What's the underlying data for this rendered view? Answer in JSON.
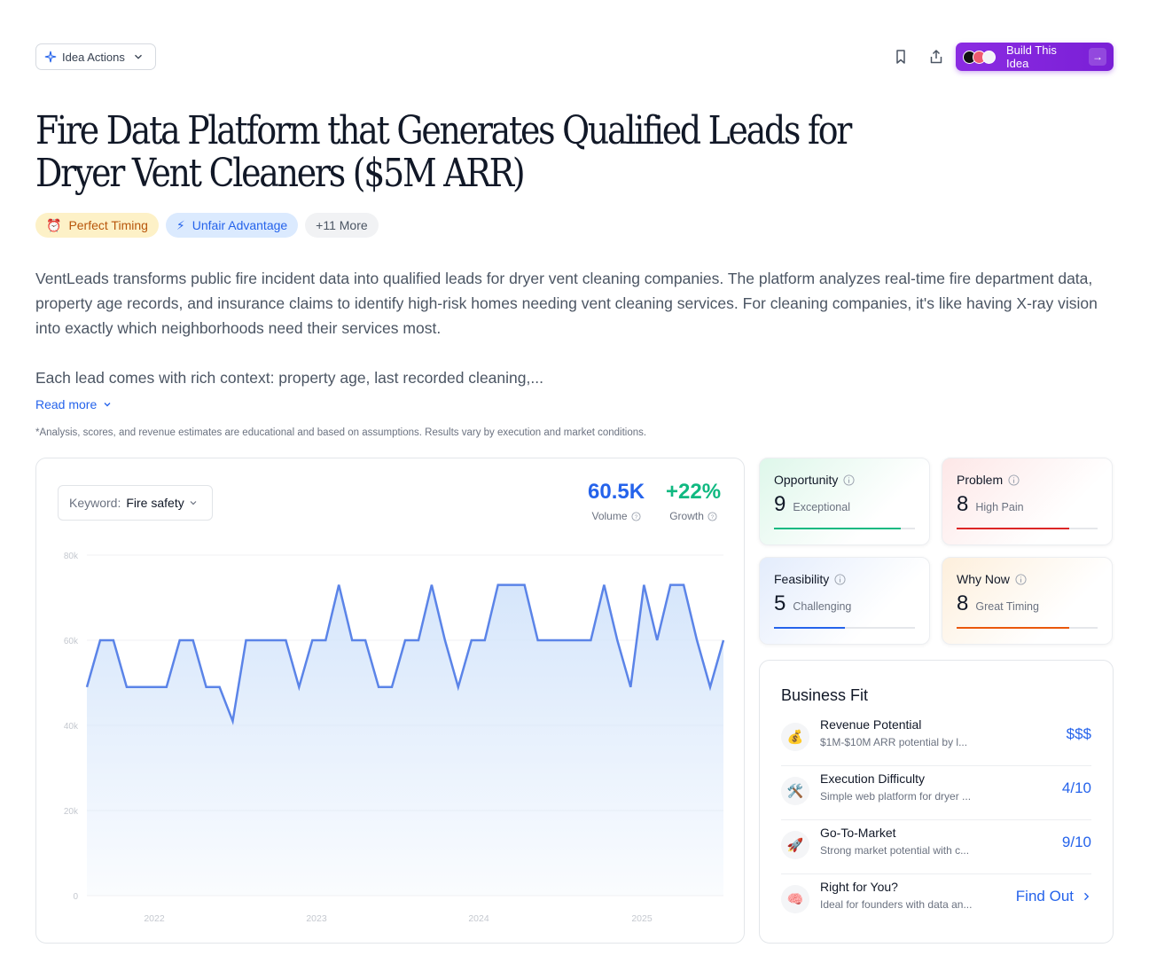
{
  "header": {
    "idea_actions_label": "Idea Actions",
    "build_label": "Build This Idea"
  },
  "title": "Fire Data Platform that Generates Qualified Leads for Dryer Vent Cleaners ($5M ARR)",
  "tags": [
    {
      "label": "Perfect Timing",
      "icon": "alarm-clock-icon"
    },
    {
      "label": "Unfair Advantage",
      "icon": "lightning-icon"
    },
    {
      "label": "+11 More"
    }
  ],
  "description": {
    "paragraph1": "VentLeads transforms public fire incident data into qualified leads for dryer vent cleaning companies. The platform analyzes real-time fire department data, property age records, and insurance claims to identify high-risk homes needing vent cleaning services. For cleaning companies, it's like having X-ray vision into exactly which neighborhoods need their services most.",
    "paragraph2": "Each lead comes with rich context: property age, last recorded cleaning,...",
    "read_more": "Read more",
    "disclaimer": "*Analysis, scores, and revenue estimates are educational and based on assumptions. Results vary by execution and market conditions."
  },
  "trend": {
    "keyword_label": "Keyword:",
    "keyword_value": "Fire safety",
    "volume": "60.5K",
    "volume_label": "Volume",
    "growth": "+22%",
    "growth_label": "Growth"
  },
  "chart_data": {
    "type": "area",
    "ylim": [
      0,
      80000
    ],
    "y_ticks": [
      "80k",
      "60k",
      "40k",
      "20k",
      "0"
    ],
    "x_ticks": [
      "2022",
      "2023",
      "2024",
      "2025"
    ],
    "grid": true,
    "series": [
      {
        "values": [
          49000,
          60000,
          60000,
          49000,
          49000,
          49000,
          49000,
          60000,
          60000,
          49000,
          49000,
          41000,
          60000,
          60000,
          60000,
          60000,
          49000,
          60000,
          60000,
          73000,
          60000,
          60000,
          49000,
          49000,
          60000,
          60000,
          73000,
          60000,
          49000,
          60000,
          60000,
          73000,
          73000,
          73000,
          60000,
          60000,
          60000,
          60000,
          60000,
          73000,
          60000,
          49000,
          73000,
          60000,
          73000,
          73000,
          60000,
          49000,
          60000
        ]
      }
    ],
    "colors": {
      "line": "#5b84e8",
      "fill": "#d6e6fb"
    }
  },
  "scores": [
    {
      "title": "Opportunity",
      "value": "9",
      "sub": "Exceptional",
      "fill": 0.9,
      "color": "#10b981"
    },
    {
      "title": "Problem",
      "value": "8",
      "sub": "High Pain",
      "fill": 0.8,
      "color": "#dc2626"
    },
    {
      "title": "Feasibility",
      "value": "5",
      "sub": "Challenging",
      "fill": 0.5,
      "color": "#2563eb"
    },
    {
      "title": "Why Now",
      "value": "8",
      "sub": "Great Timing",
      "fill": 0.8,
      "color": "#ea580c"
    }
  ],
  "business_fit": {
    "title": "Business Fit",
    "rows": [
      {
        "icon": "money-bag-icon",
        "glyph": "💰",
        "name": "Revenue Potential",
        "desc": "$1M-$10M ARR potential by l...",
        "value": "$$$"
      },
      {
        "icon": "tools-icon",
        "glyph": "🛠️",
        "name": "Execution Difficulty",
        "desc": "Simple web platform for dryer ...",
        "value": "4/10"
      },
      {
        "icon": "rocket-icon",
        "glyph": "🚀",
        "name": "Go-To-Market",
        "desc": "Strong market potential with c...",
        "value": "9/10"
      },
      {
        "icon": "brain-icon",
        "glyph": "🧠",
        "name": "Right for You?",
        "desc": "Ideal for founders with data an...",
        "value": "Find Out"
      }
    ]
  }
}
